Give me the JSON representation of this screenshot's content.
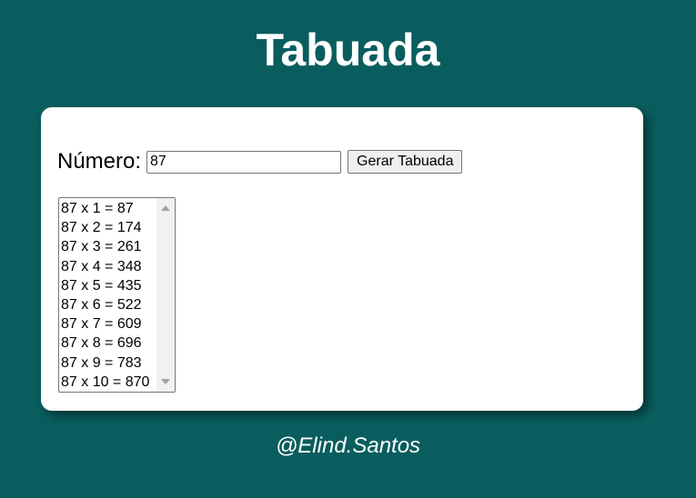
{
  "header": {
    "title": "Tabuada"
  },
  "form": {
    "number_label": "Número:",
    "number_value": "87",
    "generate_button": "Gerar Tabuada"
  },
  "results": {
    "items": [
      "87 x 1 = 87",
      "87 x 2 = 174",
      "87 x 3 = 261",
      "87 x 4 = 348",
      "87 x 5 = 435",
      "87 x 6 = 522",
      "87 x 7 = 609",
      "87 x 8 = 696",
      "87 x 9 = 783",
      "87 x 10 = 870"
    ]
  },
  "footer": {
    "credit": "@Elind.Santos"
  },
  "colors": {
    "background": "#0a5d5e",
    "card": "#ffffff",
    "title_text": "#ffffff"
  }
}
